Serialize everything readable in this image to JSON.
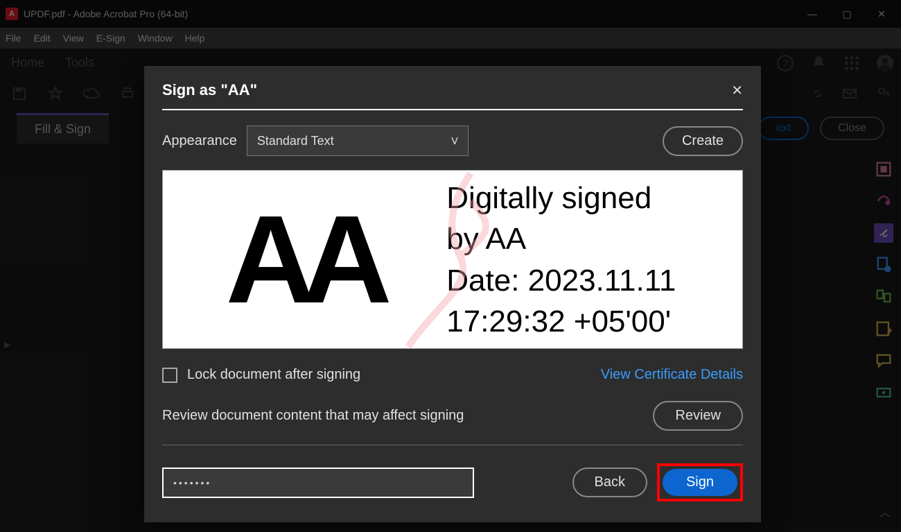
{
  "window": {
    "title": "UPDF.pdf - Adobe Acrobat Pro (64-bit)"
  },
  "menu": {
    "file": "File",
    "edit": "Edit",
    "view": "View",
    "esign": "E-Sign",
    "window": "Window",
    "help": "Help"
  },
  "tabs": {
    "home": "Home",
    "tools": "Tools"
  },
  "subbar": {
    "fill_sign": "Fill & Sign",
    "next": "ext",
    "close": "Close"
  },
  "dialog": {
    "title": "Sign as \"AA\"",
    "appearance_label": "Appearance",
    "appearance_value": "Standard Text",
    "create": "Create",
    "preview_initials": "AA",
    "preview_line1": "Digitally signed",
    "preview_line2": "by AA",
    "preview_line3": "Date: 2023.11.11",
    "preview_line4": "17:29:32 +05'00'",
    "lock_label": "Lock document after signing",
    "cert_link": "View Certificate Details",
    "review_text": "Review document content that may affect signing",
    "review_btn": "Review",
    "password_value": "•••••••",
    "back": "Back",
    "sign": "Sign"
  },
  "icons": {
    "minimize": "—",
    "maximize": "▢",
    "close": "✕",
    "chevron": "ᐯ"
  }
}
